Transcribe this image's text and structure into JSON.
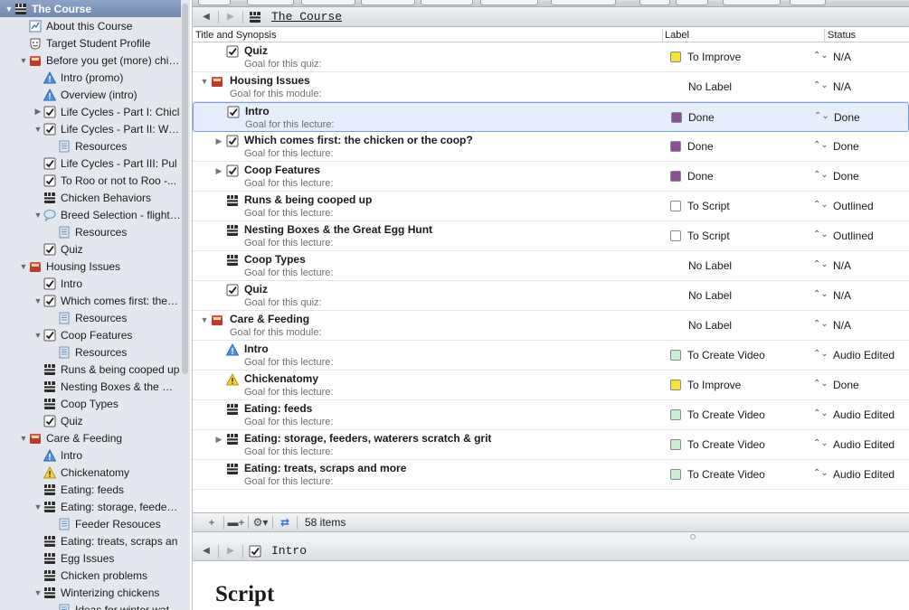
{
  "sidebar": {
    "items": [
      {
        "label": "The Course",
        "icon": "clapper-icon",
        "tri": "▼",
        "indent": 0,
        "selected": true
      },
      {
        "label": "About this Course",
        "icon": "chart-icon",
        "tri": "",
        "indent": 1
      },
      {
        "label": "Target Student Profile",
        "icon": "smiley-icon",
        "tri": "",
        "indent": 1
      },
      {
        "label": "Before you get (more) chic...",
        "icon": "red-folder-icon",
        "tri": "▼",
        "indent": 1
      },
      {
        "label": "Intro (promo)",
        "icon": "blue-warning-icon",
        "tri": "",
        "indent": 2
      },
      {
        "label": "Overview (intro)",
        "icon": "blue-warning-icon",
        "tri": "",
        "indent": 2
      },
      {
        "label": "Life Cycles - Part I: Chicl",
        "icon": "check-icon",
        "tri": "▶",
        "indent": 2
      },
      {
        "label": "Life Cycles - Part II: We...",
        "icon": "check-icon",
        "tri": "▼",
        "indent": 2
      },
      {
        "label": "Resources",
        "icon": "doc-icon",
        "tri": "",
        "indent": 3
      },
      {
        "label": "Life Cycles - Part III: Pul",
        "icon": "check-icon",
        "tri": "",
        "indent": 2
      },
      {
        "label": "To Roo or not to Roo -...",
        "icon": "check-icon",
        "tri": "",
        "indent": 2
      },
      {
        "label": "Chicken Behaviors",
        "icon": "clapper-icon",
        "tri": "",
        "indent": 2
      },
      {
        "label": "Breed Selection - flighty...",
        "icon": "speech-icon",
        "tri": "▼",
        "indent": 2
      },
      {
        "label": "Resources",
        "icon": "doc-icon",
        "tri": "",
        "indent": 3
      },
      {
        "label": "Quiz",
        "icon": "check-icon",
        "tri": "",
        "indent": 2
      },
      {
        "label": "Housing Issues",
        "icon": "red-folder-icon",
        "tri": "▼",
        "indent": 1
      },
      {
        "label": "Intro",
        "icon": "check-icon",
        "tri": "",
        "indent": 2
      },
      {
        "label": "Which comes first: the c...",
        "icon": "check-icon",
        "tri": "▼",
        "indent": 2
      },
      {
        "label": "Resources",
        "icon": "doc-icon",
        "tri": "",
        "indent": 3
      },
      {
        "label": "Coop Features",
        "icon": "check-icon",
        "tri": "▼",
        "indent": 2
      },
      {
        "label": "Resources",
        "icon": "doc-icon",
        "tri": "",
        "indent": 3
      },
      {
        "label": "Runs & being cooped up",
        "icon": "clapper-icon",
        "tri": "",
        "indent": 2
      },
      {
        "label": "Nesting Boxes & the Gr...",
        "icon": "clapper-icon",
        "tri": "",
        "indent": 2
      },
      {
        "label": "Coop Types",
        "icon": "clapper-icon",
        "tri": "",
        "indent": 2
      },
      {
        "label": "Quiz",
        "icon": "check-icon",
        "tri": "",
        "indent": 2
      },
      {
        "label": "Care & Feeding",
        "icon": "red-folder-icon",
        "tri": "▼",
        "indent": 1
      },
      {
        "label": "Intro",
        "icon": "blue-warning-icon",
        "tri": "",
        "indent": 2
      },
      {
        "label": "Chickenatomy",
        "icon": "yellow-warning-icon",
        "tri": "",
        "indent": 2
      },
      {
        "label": "Eating: feeds",
        "icon": "clapper-icon",
        "tri": "",
        "indent": 2
      },
      {
        "label": "Eating: storage, feeders...",
        "icon": "clapper-icon",
        "tri": "▼",
        "indent": 2
      },
      {
        "label": "Feeder Resouces",
        "icon": "doc-icon",
        "tri": "",
        "indent": 3
      },
      {
        "label": "Eating: treats, scraps an",
        "icon": "clapper-icon",
        "tri": "",
        "indent": 2
      },
      {
        "label": "Egg Issues",
        "icon": "clapper-icon",
        "tri": "",
        "indent": 2
      },
      {
        "label": "Chicken problems",
        "icon": "clapper-icon",
        "tri": "",
        "indent": 2
      },
      {
        "label": "Winterizing chickens",
        "icon": "clapper-icon",
        "tri": "▼",
        "indent": 2
      },
      {
        "label": "Ideas for winter wate...",
        "icon": "doc-icon",
        "tri": "",
        "indent": 3
      }
    ]
  },
  "navbar_top": {
    "title": "The Course",
    "back": "◀",
    "forward": "▶"
  },
  "columns": {
    "title": "Title and Synopsis",
    "label": "Label",
    "status": "Status"
  },
  "rows": [
    {
      "title": "Quiz",
      "synopsis": "Goal for this quiz:",
      "icon": "check-icon",
      "tri": "",
      "indent": 1,
      "label": "To Improve",
      "label_color": "#f5e23b",
      "status": "N/A"
    },
    {
      "title": "Housing Issues",
      "synopsis": "Goal for this module:",
      "icon": "red-folder-icon",
      "tri": "▼",
      "indent": 0,
      "label": "No Label",
      "label_color": "",
      "status": "N/A"
    },
    {
      "title": "Intro",
      "synopsis": "Goal for this lecture:",
      "icon": "check-icon",
      "tri": "",
      "indent": 1,
      "label": "Done",
      "label_color": "#8b4f93",
      "status": "Done",
      "selected": true
    },
    {
      "title": "Which comes first: the chicken or the coop?",
      "synopsis": "Goal for this lecture:",
      "icon": "check-icon",
      "tri": "▶",
      "indent": 1,
      "label": "Done",
      "label_color": "#8b4f93",
      "status": "Done"
    },
    {
      "title": "Coop Features",
      "synopsis": "Goal for this lecture:",
      "icon": "check-icon",
      "tri": "▶",
      "indent": 1,
      "label": "Done",
      "label_color": "#8b4f93",
      "status": "Done"
    },
    {
      "title": "Runs & being cooped up",
      "synopsis": "Goal for this lecture:",
      "icon": "clapper-icon",
      "tri": "",
      "indent": 1,
      "label": "To Script",
      "label_color": "#ffffff",
      "status": "Outlined"
    },
    {
      "title": "Nesting Boxes & the Great Egg Hunt",
      "synopsis": "Goal for this lecture:",
      "icon": "clapper-icon",
      "tri": "",
      "indent": 1,
      "label": "To Script",
      "label_color": "#ffffff",
      "status": "Outlined"
    },
    {
      "title": "Coop Types",
      "synopsis": "Goal for this lecture:",
      "icon": "clapper-icon",
      "tri": "",
      "indent": 1,
      "label": "No Label",
      "label_color": "",
      "status": "N/A"
    },
    {
      "title": "Quiz",
      "synopsis": "Goal for this quiz:",
      "icon": "check-icon",
      "tri": "",
      "indent": 1,
      "label": "No Label",
      "label_color": "",
      "status": "N/A"
    },
    {
      "title": "Care & Feeding",
      "synopsis": "Goal for this module:",
      "icon": "red-folder-icon",
      "tri": "▼",
      "indent": 0,
      "label": "No Label",
      "label_color": "",
      "status": "N/A"
    },
    {
      "title": "Intro",
      "synopsis": "Goal for this lecture:",
      "icon": "blue-warning-icon",
      "tri": "",
      "indent": 1,
      "label": "To Create Video",
      "label_color": "#c9ecd5",
      "status": "Audio Edited"
    },
    {
      "title": "Chickenatomy",
      "synopsis": "Goal for this lecture:",
      "icon": "yellow-warning-icon",
      "tri": "",
      "indent": 1,
      "label": "To Improve",
      "label_color": "#f5e23b",
      "status": "Done"
    },
    {
      "title": "Eating: feeds",
      "synopsis": "Goal for this lecture:",
      "icon": "clapper-icon",
      "tri": "",
      "indent": 1,
      "label": "To Create Video",
      "label_color": "#c9ecd5",
      "status": "Audio Edited"
    },
    {
      "title": "Eating: storage, feeders, waterers scratch & grit",
      "synopsis": "Goal for this lecture:",
      "icon": "clapper-icon",
      "tri": "▶",
      "indent": 1,
      "label": "To Create Video",
      "label_color": "#c9ecd5",
      "status": "Audio Edited"
    },
    {
      "title": "Eating: treats, scraps and more",
      "synopsis": "Goal for this lecture:",
      "icon": "clapper-icon",
      "tri": "",
      "indent": 1,
      "label": "To Create Video",
      "label_color": "#c9ecd5",
      "status": "Audio Edited"
    }
  ],
  "bottombar": {
    "add": "+",
    "add_folder": "▬+",
    "gear": "⚙▾",
    "sync": "⇄",
    "count": "58 items"
  },
  "navbar_bottom": {
    "title": "Intro",
    "back": "◀",
    "forward": "▶"
  },
  "editor": {
    "heading": "Script"
  },
  "colors": {
    "sidebar_bg": "#e4e8ee",
    "selection": "#7a9cd6",
    "accent": "#3b82e0"
  }
}
